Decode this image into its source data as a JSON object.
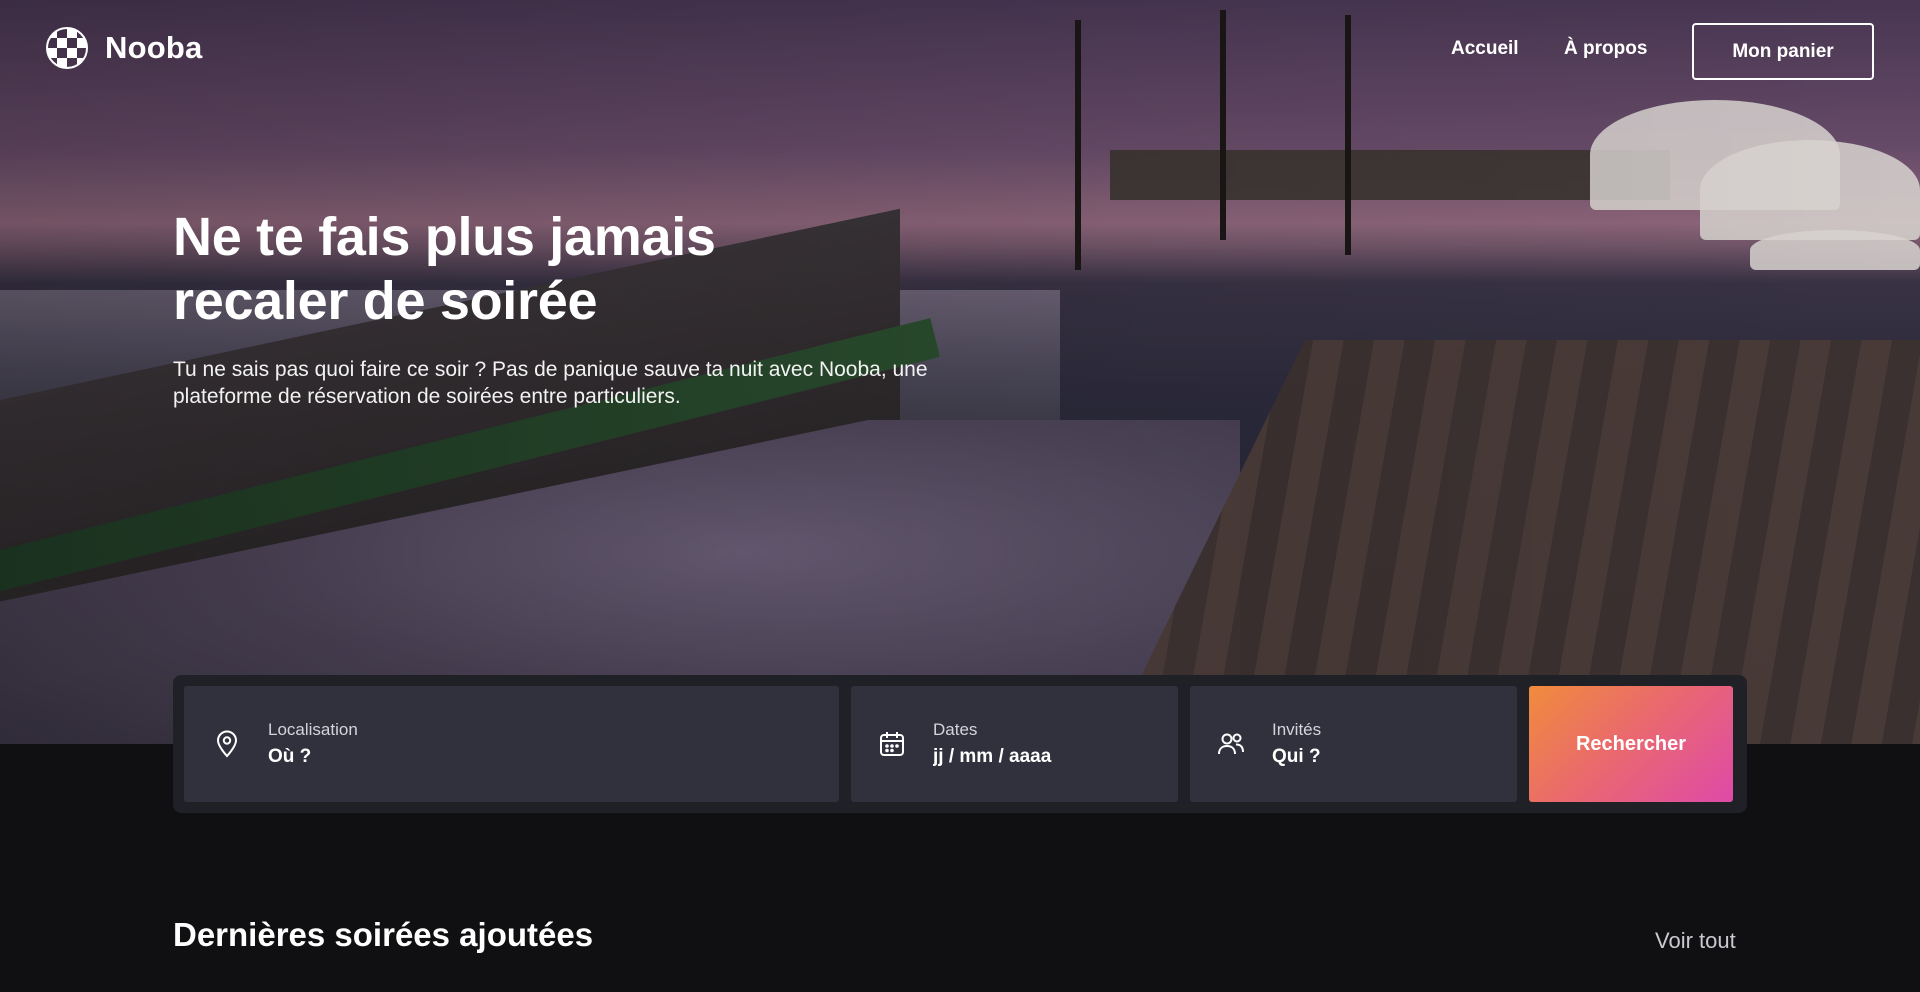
{
  "brand": {
    "name": "Nooba",
    "logo_icon": "checkered-circle-logo"
  },
  "nav": {
    "home_label": "Accueil",
    "about_label": "À propos",
    "cart_label": "Mon panier"
  },
  "hero": {
    "title": "Ne te fais plus jamais recaler de soirée",
    "subtitle": "Tu ne sais pas quoi faire ce soir ? Pas de panique sauve ta nuit avec Nooba, une plateforme de réservation de soirées entre particuliers."
  },
  "search": {
    "location": {
      "icon": "map-pin-icon",
      "label": "Localisation",
      "placeholder": "Où ?"
    },
    "dates": {
      "icon": "calendar-icon",
      "label": "Dates",
      "placeholder": "jj / mm / aaaa"
    },
    "guests": {
      "icon": "users-icon",
      "label": "Invités",
      "placeholder": "Qui ?"
    },
    "button_label": "Rechercher",
    "button_gradient": [
      "#f08c3c",
      "#ea6a6c",
      "#de4aa8"
    ]
  },
  "latest": {
    "title": "Dernières soirées ajoutées",
    "see_all_label": "Voir tout"
  },
  "colors": {
    "page_background": "#101012",
    "search_panel": "#202126",
    "field_background": "#30313c",
    "text": "#ffffff"
  }
}
